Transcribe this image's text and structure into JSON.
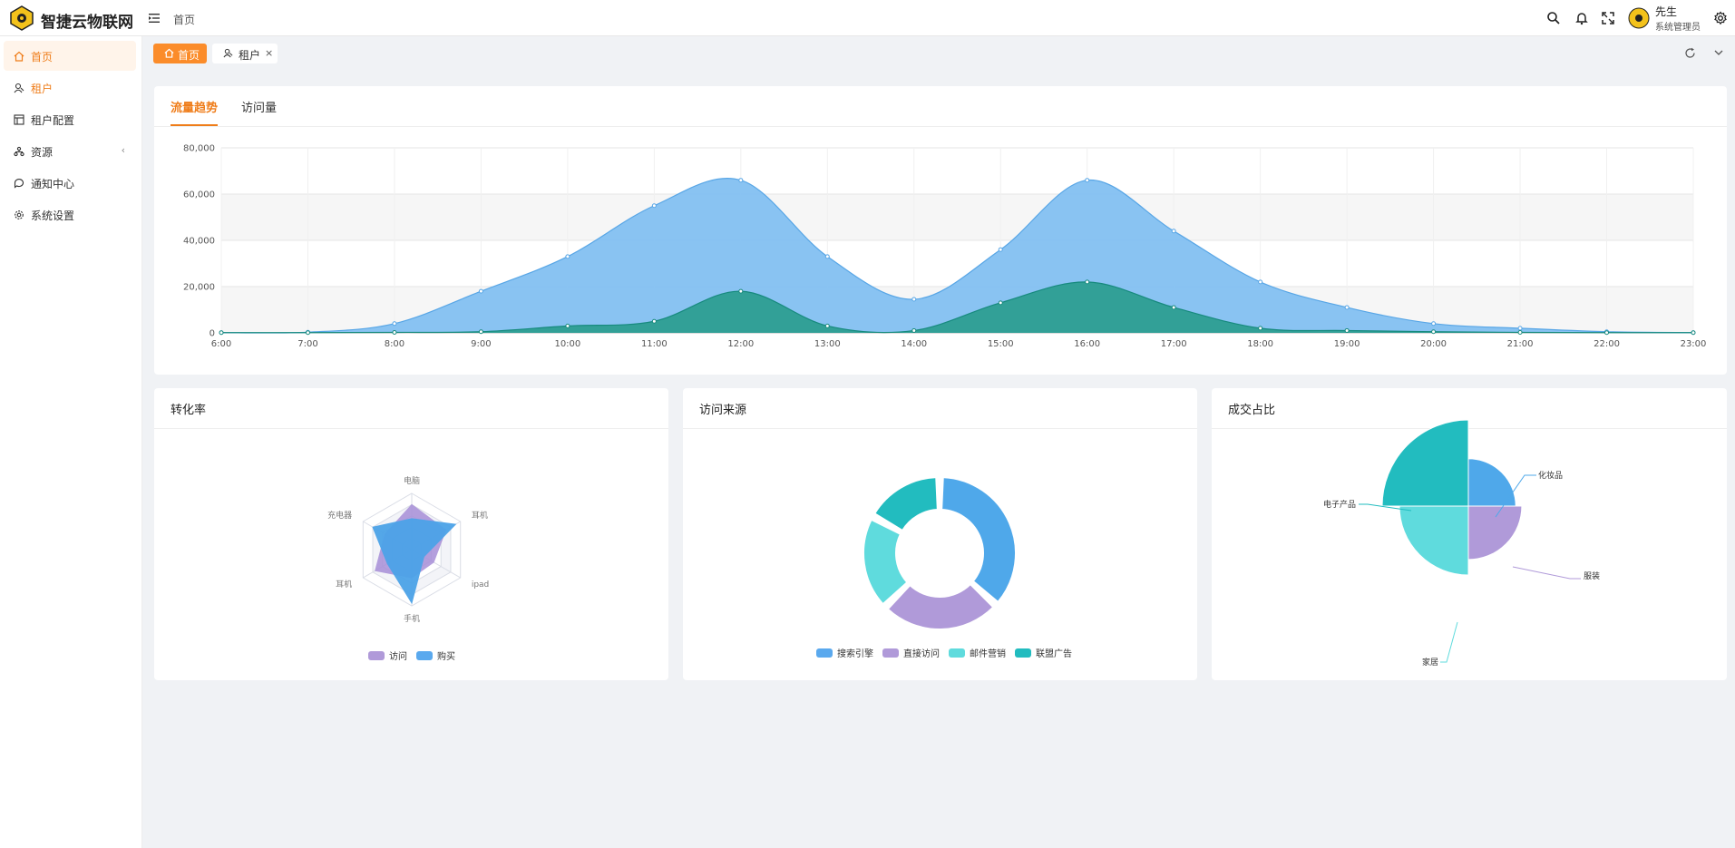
{
  "header": {
    "app_title": "智捷云物联网",
    "breadcrumb": "首页",
    "user_name": "先生",
    "user_role": "系统管理员",
    "icons": [
      "menu-fold-icon",
      "search-icon",
      "bell-icon",
      "fullscreen-icon",
      "gear-icon"
    ]
  },
  "sidebar": {
    "items": [
      {
        "label": "首页",
        "icon": "home-icon"
      },
      {
        "label": "租户",
        "icon": "user-icon"
      },
      {
        "label": "租户配置",
        "icon": "config-icon"
      },
      {
        "label": "资源",
        "icon": "resource-icon",
        "caret": "‹"
      },
      {
        "label": "通知中心",
        "icon": "message-icon"
      },
      {
        "label": "系统设置",
        "icon": "gear-icon"
      }
    ]
  },
  "tabs": {
    "home": "首页",
    "tenant": "租户",
    "close": "×"
  },
  "colors": {
    "accent": "#ef7d1a",
    "tab_active": "#fb8c2a",
    "blue": "#5aa9ee",
    "purple": "#b09ad9",
    "cyan": "#5fdbdd",
    "teal": "#22bcbf",
    "dark_teal": "#1e9b8d"
  },
  "trend_card": {
    "tabs": [
      "流量趋势",
      "访问量"
    ],
    "chart_data": {
      "type": "area",
      "x": [
        "6:00",
        "7:00",
        "8:00",
        "9:00",
        "10:00",
        "11:00",
        "12:00",
        "13:00",
        "14:00",
        "15:00",
        "16:00",
        "17:00",
        "18:00",
        "19:00",
        "20:00",
        "21:00",
        "22:00",
        "23:00"
      ],
      "series": [
        {
          "values": [
            100,
            300,
            4000,
            18000,
            33000,
            55000,
            66000,
            33000,
            14500,
            36000,
            66000,
            44000,
            22000,
            11000,
            4000,
            2000,
            500,
            100
          ]
        },
        {
          "values": [
            100,
            100,
            200,
            500,
            3000,
            5000,
            18000,
            3000,
            1000,
            13000,
            22000,
            11000,
            2000,
            1000,
            500,
            200,
            100,
            100
          ]
        }
      ],
      "ylim": [
        0,
        80000
      ],
      "yticks": [
        "0",
        "20,000",
        "40,000",
        "60,000",
        "80,000"
      ],
      "grid": true
    }
  },
  "radar_card": {
    "title": "转化率",
    "chart_data": {
      "type": "radar",
      "indicators": [
        "电脑",
        "耳机",
        "ipad",
        "手机",
        "耳机",
        "充电器"
      ],
      "series": [
        {
          "name": "访问",
          "values": [
            0.8,
            0.7,
            0.45,
            0.5,
            0.75,
            0.55
          ]
        },
        {
          "name": "购买",
          "values": [
            0.55,
            0.9,
            0.25,
            0.95,
            0.5,
            0.8
          ]
        }
      ],
      "legend": [
        "访问",
        "购买"
      ]
    }
  },
  "donut_card": {
    "title": "访问来源",
    "chart_data": {
      "type": "pie",
      "categories": [
        "搜索引擎",
        "直接访问",
        "邮件营销",
        "联盟广告"
      ],
      "values": [
        1048,
        735,
        580,
        484
      ],
      "legend": [
        "搜索引擎",
        "直接访问",
        "邮件营销",
        "联盟广告"
      ]
    }
  },
  "rose_card": {
    "title": "成交占比",
    "chart_data": {
      "type": "pie",
      "categories": [
        "化妆品",
        "服装",
        "家居",
        "电子产品"
      ],
      "values": [
        40,
        50,
        65,
        95
      ],
      "labels": [
        "化妆品",
        "服装",
        "家居",
        "电子产品"
      ]
    }
  }
}
